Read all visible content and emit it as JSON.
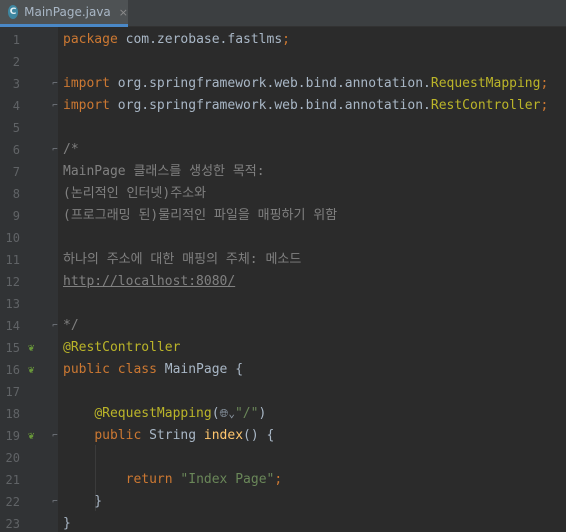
{
  "tab": {
    "icon_letter": "C",
    "filename": "MainPage.java",
    "close_glyph": "×"
  },
  "lines": [
    {
      "n": "1",
      "tokens": [
        {
          "c": "k",
          "t": "package "
        },
        {
          "c": "pl",
          "t": "com.zerobase.fastlms"
        },
        {
          "c": "k",
          "t": ";"
        }
      ]
    },
    {
      "n": "2",
      "tokens": []
    },
    {
      "n": "3",
      "tokens": [
        {
          "c": "k",
          "t": "import "
        },
        {
          "c": "pl",
          "t": "org.springframework.web.bind.annotation."
        },
        {
          "c": "an",
          "t": "RequestMapping"
        },
        {
          "c": "k",
          "t": ";"
        }
      ]
    },
    {
      "n": "4",
      "tokens": [
        {
          "c": "k",
          "t": "import "
        },
        {
          "c": "pl",
          "t": "org.springframework.web.bind.annotation."
        },
        {
          "c": "an",
          "t": "RestController"
        },
        {
          "c": "k",
          "t": ";"
        }
      ]
    },
    {
      "n": "5",
      "tokens": []
    },
    {
      "n": "6",
      "tokens": [
        {
          "c": "cm",
          "t": "/*"
        }
      ]
    },
    {
      "n": "7",
      "tokens": [
        {
          "c": "cm",
          "t": "MainPage 클래스를 생성한 목적:"
        }
      ]
    },
    {
      "n": "8",
      "tokens": [
        {
          "c": "cm",
          "t": "(논리적인 인터넷)주소와"
        }
      ]
    },
    {
      "n": "9",
      "tokens": [
        {
          "c": "cm",
          "t": "(프로그래밍 된)물리적인 파일을 매핑하기 위함"
        }
      ]
    },
    {
      "n": "10",
      "tokens": []
    },
    {
      "n": "11",
      "tokens": [
        {
          "c": "cm",
          "t": "하나의 주소에 대한 매핑의 주체: 메소드"
        }
      ]
    },
    {
      "n": "12",
      "tokens": [
        {
          "c": "lnk",
          "t": "http://localhost:8080/"
        }
      ]
    },
    {
      "n": "13",
      "tokens": []
    },
    {
      "n": "14",
      "tokens": [
        {
          "c": "cm",
          "t": "*/"
        }
      ]
    },
    {
      "n": "15",
      "tokens": [
        {
          "c": "an",
          "t": "@RestController"
        }
      ]
    },
    {
      "n": "16",
      "tokens": [
        {
          "c": "k",
          "t": "public class "
        },
        {
          "c": "pl",
          "t": "MainPage {"
        }
      ]
    },
    {
      "n": "17",
      "tokens": []
    },
    {
      "n": "18",
      "tokens": [
        {
          "c": "pl",
          "t": "    "
        },
        {
          "c": "an",
          "t": "@RequestMapping"
        },
        {
          "c": "pl",
          "t": "("
        },
        {
          "c": "globe",
          "t": "🌐︎⌄"
        },
        {
          "c": "st",
          "t": "\"/\""
        },
        {
          "c": "pl",
          "t": ")"
        }
      ]
    },
    {
      "n": "19",
      "tokens": [
        {
          "c": "pl",
          "t": "    "
        },
        {
          "c": "k",
          "t": "public "
        },
        {
          "c": "pl",
          "t": "String "
        },
        {
          "c": "fn",
          "t": "index"
        },
        {
          "c": "pl",
          "t": "() {"
        }
      ]
    },
    {
      "n": "20",
      "tokens": []
    },
    {
      "n": "21",
      "tokens": [
        {
          "c": "pl",
          "t": "        "
        },
        {
          "c": "k",
          "t": "return "
        },
        {
          "c": "st",
          "t": "\"Index Page\""
        },
        {
          "c": "k",
          "t": ";"
        }
      ]
    },
    {
      "n": "22",
      "tokens": [
        {
          "c": "pl",
          "t": "    }"
        }
      ]
    },
    {
      "n": "23",
      "tokens": [
        {
          "c": "pl",
          "t": "}"
        }
      ]
    }
  ],
  "gutter_markers": [
    {
      "line": "15",
      "icon": "spring-bean-icon",
      "glyph": "❦"
    },
    {
      "line": "16",
      "icon": "spring-bean-search-icon",
      "glyph": "❦"
    },
    {
      "line": "19",
      "icon": "spring-web-endpoint-icon",
      "glyph": "❦"
    }
  ],
  "fold_markers": [
    {
      "line": "3",
      "glyph": "⌐"
    },
    {
      "line": "4",
      "glyph": "⌐"
    },
    {
      "line": "6",
      "glyph": "⌐"
    },
    {
      "line": "14",
      "glyph": "⌐"
    },
    {
      "line": "19",
      "glyph": "⌐"
    },
    {
      "line": "22",
      "glyph": "⌐"
    }
  ],
  "colors": {
    "background": "#2b2b2b",
    "gutter": "#313335",
    "keyword": "#cc7832",
    "annotation": "#bbb529",
    "comment": "#808080",
    "string": "#6a8759",
    "method": "#ffc66d",
    "text": "#a9b7c6",
    "tab_underline": "#4a88c7"
  }
}
